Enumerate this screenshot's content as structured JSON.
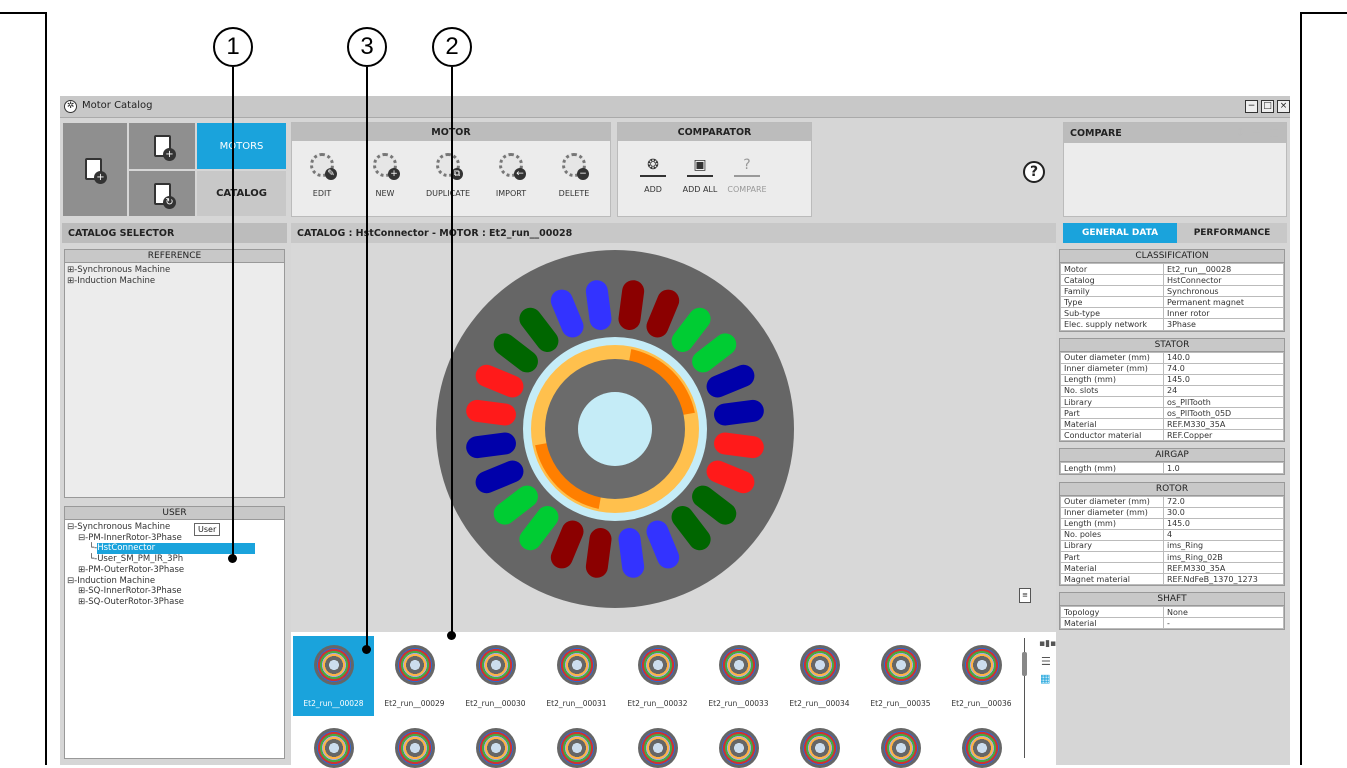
{
  "callouts": [
    "1",
    "3",
    "2"
  ],
  "window": {
    "title": "Motor Catalog",
    "buttons": [
      "−",
      "□",
      "×"
    ]
  },
  "nav": {
    "motors": "MOTORS",
    "catalog": "CATALOG"
  },
  "motor_panel": {
    "title": "MOTOR",
    "buttons": [
      {
        "label": "EDIT",
        "icon": "pencil-icon",
        "badge": "✎"
      },
      {
        "label": "NEW",
        "icon": "plus-icon",
        "badge": "+"
      },
      {
        "label": "DUPLICATE",
        "icon": "duplicate-icon",
        "badge": "⧉"
      },
      {
        "label": "IMPORT",
        "icon": "import-icon",
        "badge": "←"
      },
      {
        "label": "DELETE",
        "icon": "minus-icon",
        "badge": "−"
      }
    ]
  },
  "comparator_panel": {
    "title": "COMPARATOR",
    "buttons": [
      {
        "label": "ADD",
        "glyph": "❂"
      },
      {
        "label": "ADD ALL",
        "glyph": "▣"
      },
      {
        "label": "COMPARE",
        "glyph": "?"
      }
    ]
  },
  "help": {
    "glyph": "?"
  },
  "compare_panel": {
    "title": "COMPARE",
    "icons": [
      "↕",
      "−",
      "▥"
    ]
  },
  "catalog_selector": {
    "title": "CATALOG SELECTOR",
    "reference": {
      "title": "REFERENCE",
      "items": [
        "Synchronous Machine",
        "Induction Machine"
      ]
    },
    "user": {
      "title": "USER",
      "tooltip": "User",
      "items": [
        {
          "label": "Synchronous Machine",
          "prefix": "⊟-",
          "indent": 0
        },
        {
          "label": "PM-InnerRotor-3Phase",
          "prefix": "⊟-",
          "indent": 1
        },
        {
          "label": "HstConnector",
          "prefix": "└-",
          "indent": 2,
          "selected": true
        },
        {
          "label": "User_SM_PM_IR_3Ph",
          "prefix": "└-",
          "indent": 2
        },
        {
          "label": "PM-OuterRotor-3Phase",
          "prefix": "⊞-",
          "indent": 1
        },
        {
          "label": "Induction Machine",
          "prefix": "⊟-",
          "indent": 0
        },
        {
          "label": "SQ-InnerRotor-3Phase",
          "prefix": "⊞-",
          "indent": 1
        },
        {
          "label": "SQ-OuterRotor-3Phase",
          "prefix": "⊞-",
          "indent": 1
        }
      ]
    }
  },
  "center": {
    "header": "CATALOG : HstConnector  -  MOTOR : Et2_run__00028"
  },
  "thumbnails": [
    "Et2_run__00028",
    "Et2_run__00029",
    "Et2_run__00030",
    "Et2_run__00031",
    "Et2_run__00032",
    "Et2_run__00033",
    "Et2_run__00034",
    "Et2_run__00035",
    "Et2_run__00036"
  ],
  "tabs": {
    "general": "GENERAL DATA",
    "performance": "PERFORMANCE"
  },
  "sections": [
    {
      "title": "CLASSIFICATION",
      "rows": [
        [
          "Motor",
          "Et2_run__00028"
        ],
        [
          "Catalog",
          "HstConnector"
        ],
        [
          "Family",
          "Synchronous"
        ],
        [
          "Type",
          "Permanent magnet"
        ],
        [
          "Sub-type",
          "Inner rotor"
        ],
        [
          "Elec. supply network",
          "3Phase"
        ]
      ]
    },
    {
      "title": "STATOR",
      "rows": [
        [
          "Outer diameter (mm)",
          "140.0"
        ],
        [
          "Inner diameter (mm)",
          "74.0"
        ],
        [
          "Length (mm)",
          "145.0"
        ],
        [
          "No. slots",
          "24"
        ],
        [
          "Library",
          "os_PllTooth"
        ],
        [
          "Part",
          "os_PllTooth_05D"
        ],
        [
          "Material",
          "REF.M330_35A"
        ],
        [
          "Conductor material",
          "REF.Copper"
        ]
      ]
    },
    {
      "title": "AIRGAP",
      "rows": [
        [
          "Length (mm)",
          "1.0"
        ]
      ]
    },
    {
      "title": "ROTOR",
      "rows": [
        [
          "Outer diameter (mm)",
          "72.0"
        ],
        [
          "Inner diameter (mm)",
          "30.0"
        ],
        [
          "Length (mm)",
          "145.0"
        ],
        [
          "No. poles",
          "4"
        ],
        [
          "Library",
          "ims_Ring"
        ],
        [
          "Part",
          "ims_Ring_02B"
        ],
        [
          "Material",
          "REF.M330_35A"
        ],
        [
          "Magnet material",
          "REF.NdFeB_1370_1273"
        ]
      ]
    },
    {
      "title": "SHAFT",
      "rows": [
        [
          "Topology",
          "None"
        ],
        [
          "Material",
          "-"
        ]
      ]
    }
  ],
  "colors": {
    "accent": "#1aa3dc",
    "panel": "#d6d6d6",
    "header": "#bcbcbc"
  }
}
